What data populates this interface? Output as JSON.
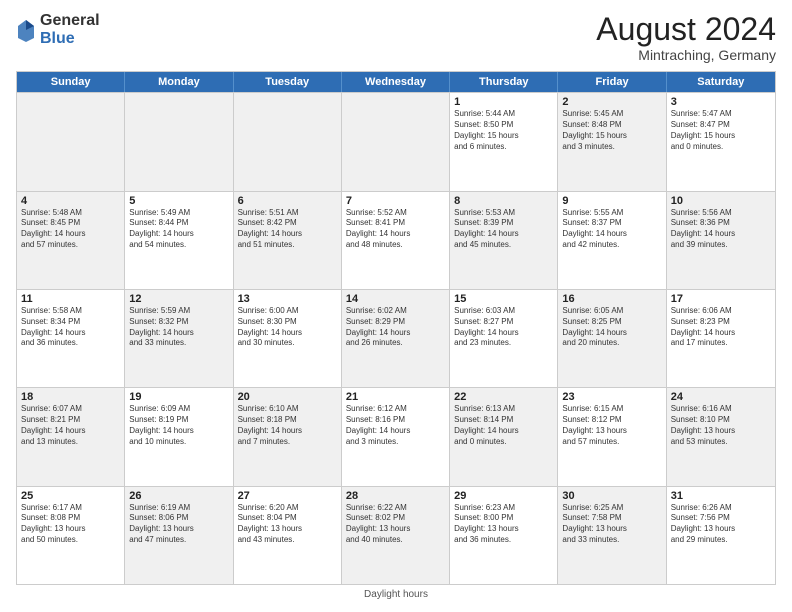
{
  "header": {
    "logo_general": "General",
    "logo_blue": "Blue",
    "month_year": "August 2024",
    "location": "Mintraching, Germany"
  },
  "footer": {
    "note": "Daylight hours"
  },
  "days_of_week": [
    "Sunday",
    "Monday",
    "Tuesday",
    "Wednesday",
    "Thursday",
    "Friday",
    "Saturday"
  ],
  "weeks": [
    [
      {
        "day": "",
        "detail": "",
        "shaded": true
      },
      {
        "day": "",
        "detail": "",
        "shaded": true
      },
      {
        "day": "",
        "detail": "",
        "shaded": true
      },
      {
        "day": "",
        "detail": "",
        "shaded": true
      },
      {
        "day": "1",
        "detail": "Sunrise: 5:44 AM\nSunset: 8:50 PM\nDaylight: 15 hours\nand 6 minutes.",
        "shaded": false
      },
      {
        "day": "2",
        "detail": "Sunrise: 5:45 AM\nSunset: 8:48 PM\nDaylight: 15 hours\nand 3 minutes.",
        "shaded": true
      },
      {
        "day": "3",
        "detail": "Sunrise: 5:47 AM\nSunset: 8:47 PM\nDaylight: 15 hours\nand 0 minutes.",
        "shaded": false
      }
    ],
    [
      {
        "day": "4",
        "detail": "Sunrise: 5:48 AM\nSunset: 8:45 PM\nDaylight: 14 hours\nand 57 minutes.",
        "shaded": true
      },
      {
        "day": "5",
        "detail": "Sunrise: 5:49 AM\nSunset: 8:44 PM\nDaylight: 14 hours\nand 54 minutes.",
        "shaded": false
      },
      {
        "day": "6",
        "detail": "Sunrise: 5:51 AM\nSunset: 8:42 PM\nDaylight: 14 hours\nand 51 minutes.",
        "shaded": true
      },
      {
        "day": "7",
        "detail": "Sunrise: 5:52 AM\nSunset: 8:41 PM\nDaylight: 14 hours\nand 48 minutes.",
        "shaded": false
      },
      {
        "day": "8",
        "detail": "Sunrise: 5:53 AM\nSunset: 8:39 PM\nDaylight: 14 hours\nand 45 minutes.",
        "shaded": true
      },
      {
        "day": "9",
        "detail": "Sunrise: 5:55 AM\nSunset: 8:37 PM\nDaylight: 14 hours\nand 42 minutes.",
        "shaded": false
      },
      {
        "day": "10",
        "detail": "Sunrise: 5:56 AM\nSunset: 8:36 PM\nDaylight: 14 hours\nand 39 minutes.",
        "shaded": true
      }
    ],
    [
      {
        "day": "11",
        "detail": "Sunrise: 5:58 AM\nSunset: 8:34 PM\nDaylight: 14 hours\nand 36 minutes.",
        "shaded": false
      },
      {
        "day": "12",
        "detail": "Sunrise: 5:59 AM\nSunset: 8:32 PM\nDaylight: 14 hours\nand 33 minutes.",
        "shaded": true
      },
      {
        "day": "13",
        "detail": "Sunrise: 6:00 AM\nSunset: 8:30 PM\nDaylight: 14 hours\nand 30 minutes.",
        "shaded": false
      },
      {
        "day": "14",
        "detail": "Sunrise: 6:02 AM\nSunset: 8:29 PM\nDaylight: 14 hours\nand 26 minutes.",
        "shaded": true
      },
      {
        "day": "15",
        "detail": "Sunrise: 6:03 AM\nSunset: 8:27 PM\nDaylight: 14 hours\nand 23 minutes.",
        "shaded": false
      },
      {
        "day": "16",
        "detail": "Sunrise: 6:05 AM\nSunset: 8:25 PM\nDaylight: 14 hours\nand 20 minutes.",
        "shaded": true
      },
      {
        "day": "17",
        "detail": "Sunrise: 6:06 AM\nSunset: 8:23 PM\nDaylight: 14 hours\nand 17 minutes.",
        "shaded": false
      }
    ],
    [
      {
        "day": "18",
        "detail": "Sunrise: 6:07 AM\nSunset: 8:21 PM\nDaylight: 14 hours\nand 13 minutes.",
        "shaded": true
      },
      {
        "day": "19",
        "detail": "Sunrise: 6:09 AM\nSunset: 8:19 PM\nDaylight: 14 hours\nand 10 minutes.",
        "shaded": false
      },
      {
        "day": "20",
        "detail": "Sunrise: 6:10 AM\nSunset: 8:18 PM\nDaylight: 14 hours\nand 7 minutes.",
        "shaded": true
      },
      {
        "day": "21",
        "detail": "Sunrise: 6:12 AM\nSunset: 8:16 PM\nDaylight: 14 hours\nand 3 minutes.",
        "shaded": false
      },
      {
        "day": "22",
        "detail": "Sunrise: 6:13 AM\nSunset: 8:14 PM\nDaylight: 14 hours\nand 0 minutes.",
        "shaded": true
      },
      {
        "day": "23",
        "detail": "Sunrise: 6:15 AM\nSunset: 8:12 PM\nDaylight: 13 hours\nand 57 minutes.",
        "shaded": false
      },
      {
        "day": "24",
        "detail": "Sunrise: 6:16 AM\nSunset: 8:10 PM\nDaylight: 13 hours\nand 53 minutes.",
        "shaded": true
      }
    ],
    [
      {
        "day": "25",
        "detail": "Sunrise: 6:17 AM\nSunset: 8:08 PM\nDaylight: 13 hours\nand 50 minutes.",
        "shaded": false
      },
      {
        "day": "26",
        "detail": "Sunrise: 6:19 AM\nSunset: 8:06 PM\nDaylight: 13 hours\nand 47 minutes.",
        "shaded": true
      },
      {
        "day": "27",
        "detail": "Sunrise: 6:20 AM\nSunset: 8:04 PM\nDaylight: 13 hours\nand 43 minutes.",
        "shaded": false
      },
      {
        "day": "28",
        "detail": "Sunrise: 6:22 AM\nSunset: 8:02 PM\nDaylight: 13 hours\nand 40 minutes.",
        "shaded": true
      },
      {
        "day": "29",
        "detail": "Sunrise: 6:23 AM\nSunset: 8:00 PM\nDaylight: 13 hours\nand 36 minutes.",
        "shaded": false
      },
      {
        "day": "30",
        "detail": "Sunrise: 6:25 AM\nSunset: 7:58 PM\nDaylight: 13 hours\nand 33 minutes.",
        "shaded": true
      },
      {
        "day": "31",
        "detail": "Sunrise: 6:26 AM\nSunset: 7:56 PM\nDaylight: 13 hours\nand 29 minutes.",
        "shaded": false
      }
    ]
  ]
}
